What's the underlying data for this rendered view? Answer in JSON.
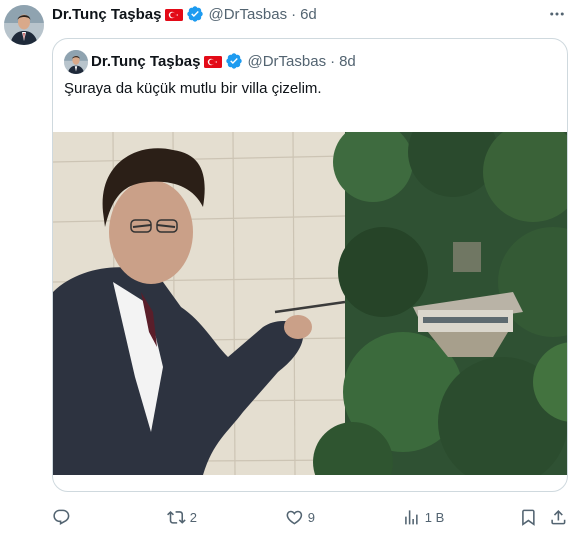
{
  "tweet": {
    "author_name": "Dr.Tunç Taşbaş",
    "handle": "@DrTasbas",
    "separator": "·",
    "time": "6d",
    "flag_icon": "turkey-flag-icon",
    "verified_icon": "verified-badge-icon"
  },
  "quoted": {
    "author_name": "Dr.Tunç Taşbaş",
    "handle": "@DrTasbas",
    "separator": "·",
    "time": "8d",
    "text": "Şuraya da küçük mutlu bir villa çizelim."
  },
  "actions": {
    "reply_count": "",
    "retweet_count": "2",
    "like_count": "9",
    "views_count": "1 B"
  },
  "colors": {
    "text_primary": "#0f1419",
    "text_secondary": "#536471",
    "border": "#cfd9de",
    "verified_blue": "#1d9bf0",
    "flag_red": "#e30a17"
  }
}
